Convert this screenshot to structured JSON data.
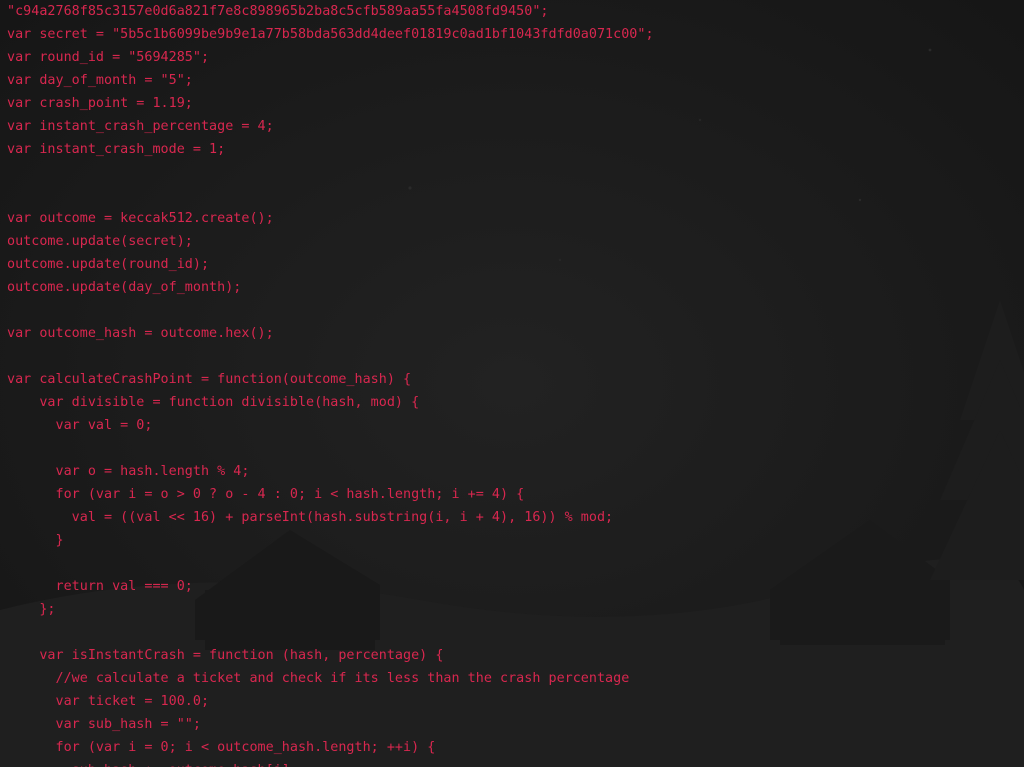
{
  "code_lines": [
    "\"c94a2768f85c3157e0d6a821f7e8c898965b2ba8c5cfb589aa55fa4508fd9450\";",
    "var secret = \"5b5c1b6099be9b9e1a77b58bda563dd4deef01819c0ad1bf1043fdfd0a071c00\";",
    "var round_id = \"5694285\";",
    "var day_of_month = \"5\";",
    "var crash_point = 1.19;",
    "var instant_crash_percentage = 4;",
    "var instant_crash_mode = 1;",
    "",
    "",
    "var outcome = keccak512.create();",
    "outcome.update(secret);",
    "outcome.update(round_id);",
    "outcome.update(day_of_month);",
    "",
    "var outcome_hash = outcome.hex();",
    "",
    "var calculateCrashPoint = function(outcome_hash) {",
    "    var divisible = function divisible(hash, mod) {",
    "      var val = 0;",
    "",
    "      var o = hash.length % 4;",
    "      for (var i = o > 0 ? o - 4 : 0; i < hash.length; i += 4) {",
    "        val = ((val << 16) + parseInt(hash.substring(i, i + 4), 16)) % mod;",
    "      }",
    "",
    "      return val === 0;",
    "    };",
    "",
    "    var isInstantCrash = function (hash, percentage) {",
    "      //we calculate a ticket and check if its less than the crash percentage",
    "      var ticket = 100.0;",
    "      var sub_hash = \"\";",
    "      for (var i = 0; i < outcome_hash.length; ++i) {",
    "        sub_hash += outcome_hash[i];"
  ],
  "colors": {
    "code_text": "#d8274f",
    "background": "#1b1b1b"
  }
}
